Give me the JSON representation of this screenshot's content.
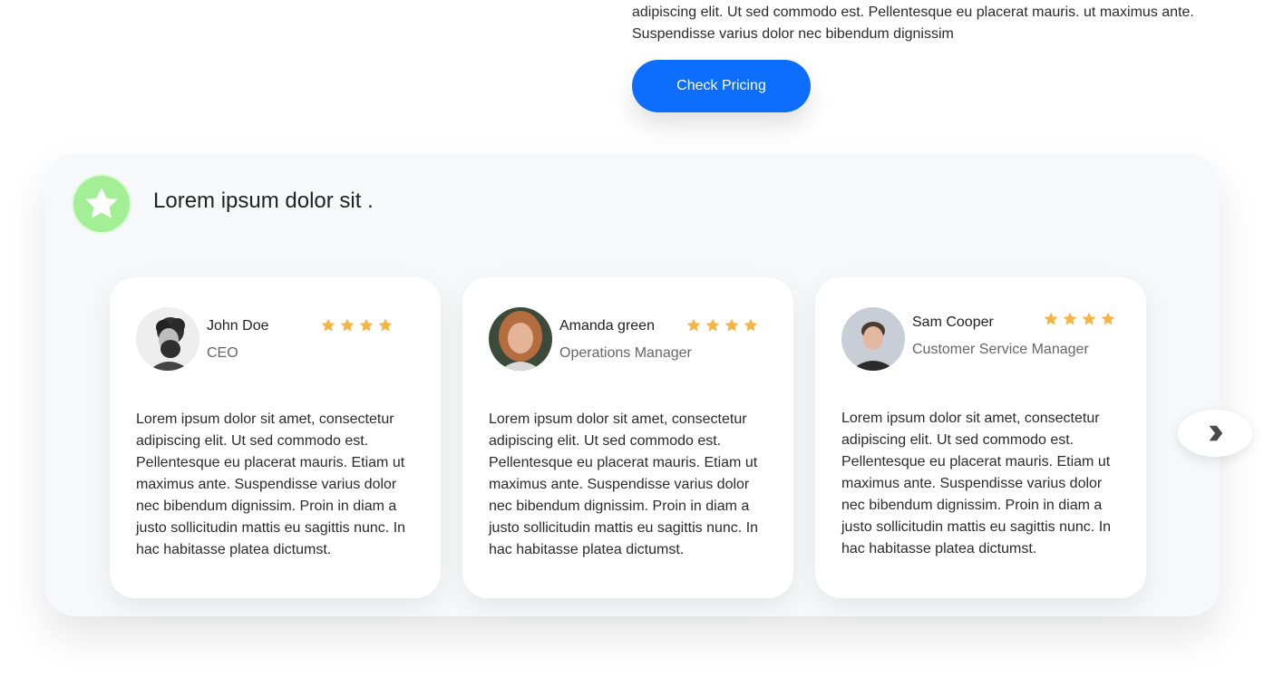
{
  "intro": {
    "text": "adipiscing elit. Ut sed commodo est. Pellentesque eu placerat mauris. ut maximus ante. Suspendisse varius dolor nec bibendum dignissim"
  },
  "cta": {
    "label": "Check Pricing"
  },
  "testimonials": {
    "title": "Lorem ipsum dolor sit .",
    "badge_icon": "star-icon",
    "colors": {
      "accent": "#0d6efd",
      "badge": "#a3ef95",
      "star": "#f4b545"
    },
    "cards": [
      {
        "name": "John Doe",
        "role": "CEO",
        "rating": 4,
        "text": "Lorem ipsum dolor sit amet, consectetur adipiscing elit. Ut sed commodo est. Pellentesque eu placerat mauris. Etiam ut maximus ante. Suspendisse varius dolor nec bibendum dignissim. Proin in diam a justo sollicitudin mattis eu sagittis nunc. In hac habitasse platea dictumst."
      },
      {
        "name": "Amanda green",
        "role": "Operations Manager",
        "rating": 4,
        "text": "Lorem ipsum dolor sit amet, consectetur adipiscing elit. Ut sed commodo est. Pellentesque eu placerat mauris. Etiam ut maximus ante. Suspendisse varius dolor nec bibendum dignissim. Proin in diam a justo sollicitudin mattis eu sagittis nunc. In hac habitasse platea dictumst."
      },
      {
        "name": "Sam Cooper",
        "role": "Customer Service Manager",
        "rating": 4,
        "text": "Lorem ipsum dolor sit amet, consectetur adipiscing elit. Ut sed commodo est. Pellentesque eu placerat mauris. Etiam ut maximus ante. Suspendisse varius dolor nec bibendum dignissim. Proin in diam a justo sollicitudin mattis eu sagittis nunc. In hac habitasse platea dictumst."
      }
    ],
    "next_icon": "chevron-right-icon"
  }
}
